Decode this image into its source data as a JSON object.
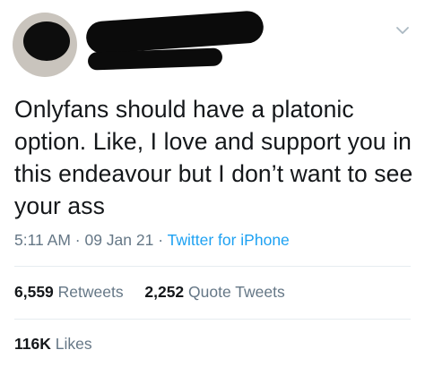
{
  "tweet": {
    "text": "Onlyfans should have a platonic option. Like, I love and support you in this endeavour but I don’t want to see your ass",
    "time": "5:11 AM",
    "separator": " · ",
    "date": "09 Jan 21",
    "source": "Twitter for iPhone"
  },
  "stats": {
    "retweets_count": "6,559",
    "retweets_label": "Retweets",
    "quotes_count": "2,252",
    "quotes_label": "Quote Tweets",
    "likes_count": "116K",
    "likes_label": "Likes"
  },
  "icons": {
    "menu": "chevron-down-icon"
  },
  "colors": {
    "text": "#14171a",
    "secondary": "#657786",
    "link": "#1da1f2",
    "divider": "#e6ecf0"
  }
}
